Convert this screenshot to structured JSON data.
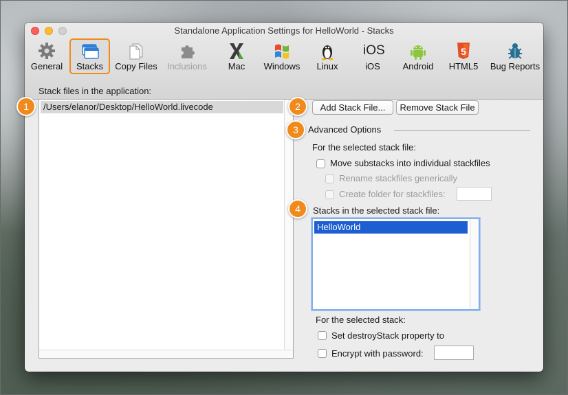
{
  "window": {
    "title": "Standalone Application Settings for HelloWorld - Stacks"
  },
  "toolbar": {
    "items": [
      {
        "label": "General",
        "icon": "gear-icon"
      },
      {
        "label": "Stacks",
        "icon": "stacks-icon",
        "selected": true
      },
      {
        "label": "Copy Files",
        "icon": "copy-files-icon"
      },
      {
        "label": "Inclusions",
        "icon": "puzzle-icon",
        "disabled": true
      },
      {
        "label": "Mac",
        "icon": "mac-x-icon"
      },
      {
        "label": "Windows",
        "icon": "windows-flag-icon"
      },
      {
        "label": "Linux",
        "icon": "linux-penguin-icon"
      },
      {
        "label": "iOS",
        "icon": "ios-text-icon",
        "icon_text": "iOS"
      },
      {
        "label": "Android",
        "icon": "android-icon"
      },
      {
        "label": "HTML5",
        "icon": "html5-icon",
        "icon_text": "5"
      },
      {
        "label": "Bug Reports",
        "icon": "bug-icon"
      }
    ]
  },
  "stack_files": {
    "label": "Stack files in the application:",
    "items": [
      "/Users/elanor/Desktop/HelloWorld.livecode"
    ]
  },
  "buttons": {
    "add_stack_file": "Add Stack File...",
    "remove_stack_file": "Remove Stack File"
  },
  "advanced": {
    "title": "Advanced Options",
    "for_selected_stack_file": "For the selected stack file:",
    "move_substacks": "Move substacks into individual stackfiles",
    "rename_stackfiles": "Rename stackfiles generically",
    "create_folder": "Create folder for stackfiles:",
    "create_folder_value": ""
  },
  "stacks_in_file": {
    "label": "Stacks in the selected stack file:",
    "items": [
      "HelloWorld"
    ]
  },
  "selected_stack": {
    "label": "For the selected stack:",
    "destroy_stack": "Set destroyStack property to",
    "encrypt": "Encrypt with password:",
    "password_value": ""
  },
  "badges": [
    "1",
    "2",
    "3",
    "4"
  ],
  "colors": {
    "accent": "#f08a1c",
    "selection": "#1d5fd1",
    "list_selection_gray": "#d8d8d8"
  }
}
